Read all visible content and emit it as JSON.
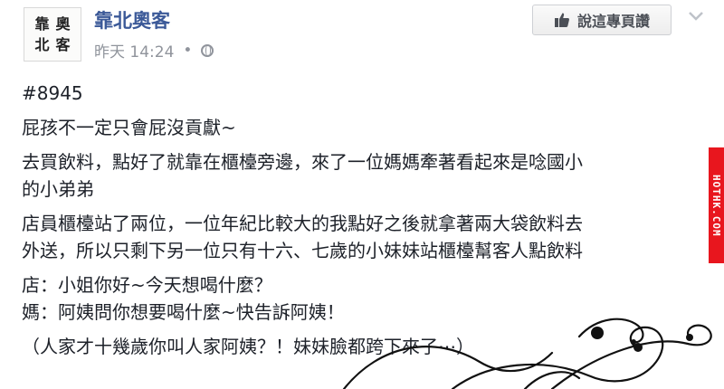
{
  "post": {
    "page_name": "靠北奧客",
    "timestamp": "昨天 14:24",
    "separator": "•",
    "avatar_chars": [
      "靠",
      "奧",
      "北",
      "客"
    ],
    "like_button_label": "說這專頁讚",
    "lines": [
      "#8945",
      "屁孩不一定只會屁沒貢獻~",
      "去買飲料，點好了就靠在櫃檯旁邊，來了一位媽媽牽著看起來是唸國小",
      "的小弟弟",
      "店員櫃檯站了兩位，一位年紀比較大的我點好之後就拿著兩大袋飲料去",
      "外送，所以只剩下另一位只有十六、七歲的小妹妹站櫃檯幫客人點飲料",
      "店：小姐你好~今天想喝什麼？",
      "媽：阿姨問你想要喝什麼~快告訴阿姨！",
      "（人家才十幾歲你叫人家阿姨？！妹妹臉都跨下來了⋯）"
    ]
  },
  "watermark": {
    "text": "HOTHK.COM",
    "color": "#e8161e"
  },
  "icons": {
    "privacy": "globe-icon",
    "like": "thumb-icon",
    "menu": "chevron-down-icon"
  }
}
